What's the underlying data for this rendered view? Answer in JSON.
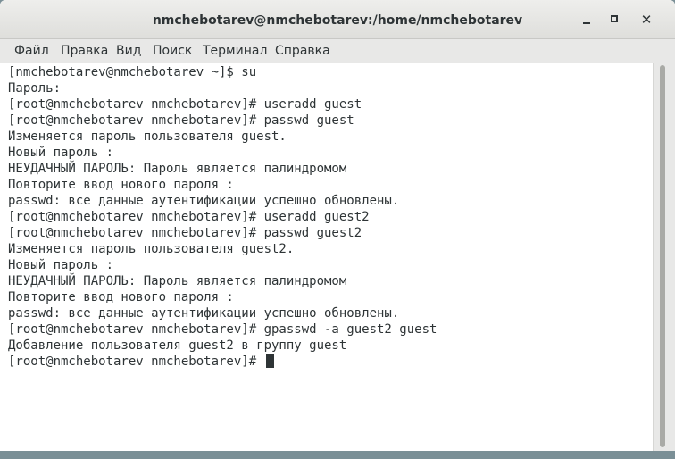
{
  "window": {
    "title": "nmchebotarev@nmchebotarev:/home/nmchebotarev",
    "minimize_icon": "minimize-icon",
    "maximize_icon": "maximize-icon",
    "close_glyph": "✕"
  },
  "menu": {
    "items": [
      "Файл",
      "Правка",
      "Вид",
      "Поиск",
      "Терминал",
      "Справка"
    ]
  },
  "terminal": {
    "lines": [
      "[nmchebotarev@nmchebotarev ~]$ su",
      "Пароль:",
      "[root@nmchebotarev nmchebotarev]# useradd guest",
      "[root@nmchebotarev nmchebotarev]# passwd guest",
      "Изменяется пароль пользователя guest.",
      "Новый пароль :",
      "НЕУДАЧНЫЙ ПАРОЛЬ: Пароль является палиндромом",
      "Повторите ввод нового пароля :",
      "passwd: все данные аутентификации успешно обновлены.",
      "[root@nmchebotarev nmchebotarev]# useradd guest2",
      "[root@nmchebotarev nmchebotarev]# passwd guest2",
      "Изменяется пароль пользователя guest2.",
      "Новый пароль :",
      "НЕУДАЧНЫЙ ПАРОЛЬ: Пароль является палиндромом",
      "Повторите ввод нового пароля :",
      "passwd: все данные аутентификации успешно обновлены.",
      "[root@nmchebotarev nmchebotarev]# gpasswd -a guest2 guest",
      "Добавление пользователя guest2 в группу guest",
      "[root@nmchebotarev nmchebotarev]# "
    ]
  }
}
